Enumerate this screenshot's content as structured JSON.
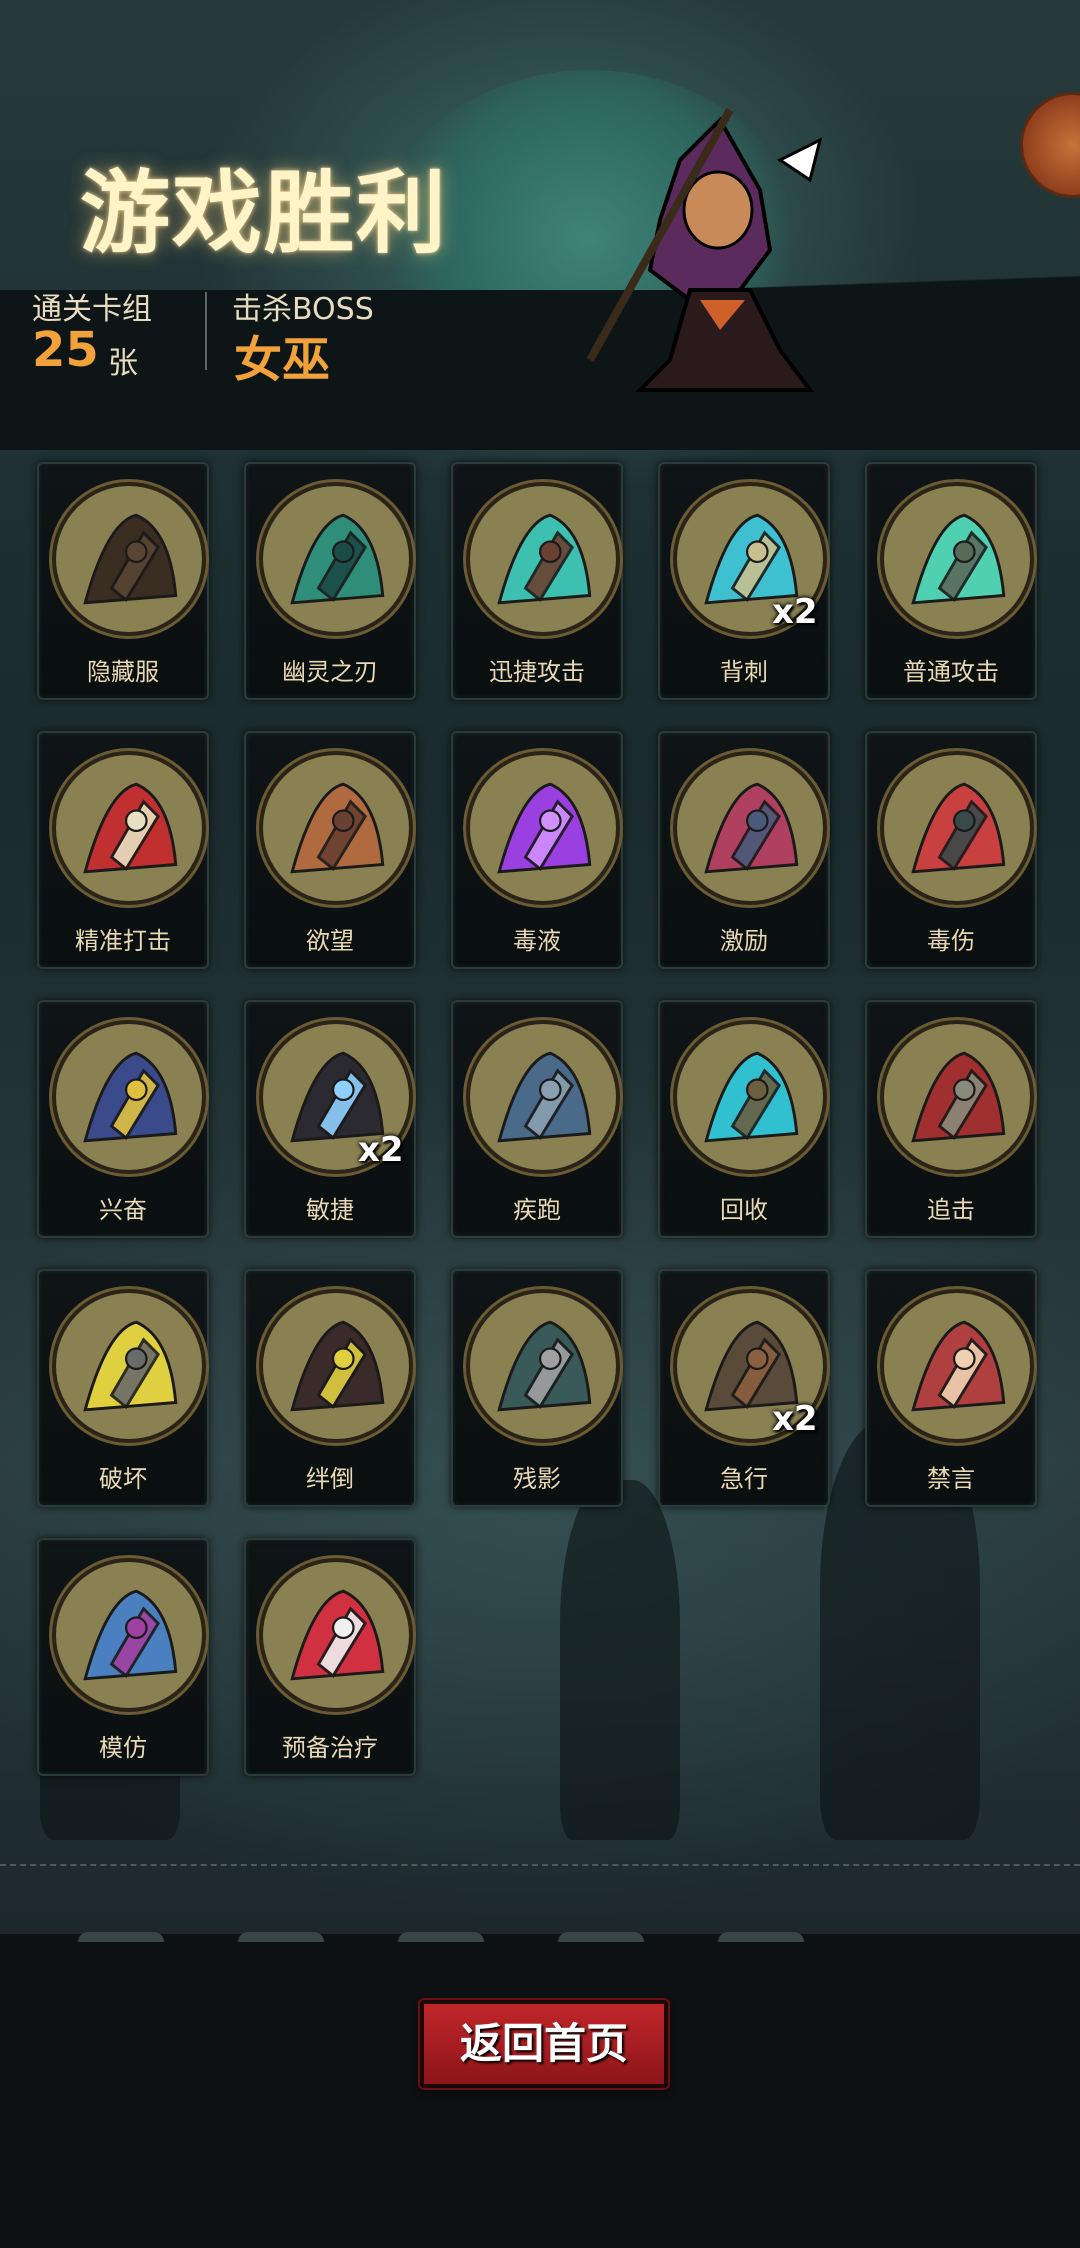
{
  "header": {
    "title": "游戏胜利",
    "deck_label": "通关卡组",
    "deck_count": "25",
    "deck_unit": "张",
    "boss_label": "击杀BOSS",
    "boss_name": "女巫"
  },
  "cards": [
    {
      "label": "隐藏服",
      "mult": "",
      "icon": "hood-cloak-icon"
    },
    {
      "label": "幽灵之刃",
      "mult": "",
      "icon": "ghost-dagger-icon"
    },
    {
      "label": "迅捷攻击",
      "mult": "",
      "icon": "swift-axe-icon"
    },
    {
      "label": "背刺",
      "mult": "x2",
      "icon": "backstab-icon"
    },
    {
      "label": "普通攻击",
      "mult": "",
      "icon": "spears-icon"
    },
    {
      "label": "精准打击",
      "mult": "",
      "icon": "target-arrows-icon"
    },
    {
      "label": "欲望",
      "mult": "",
      "icon": "greedy-toad-icon"
    },
    {
      "label": "毒液",
      "mult": "",
      "icon": "venom-splash-icon"
    },
    {
      "label": "激励",
      "mult": "",
      "icon": "hammer-warrior-icon"
    },
    {
      "label": "毒伤",
      "mult": "",
      "icon": "octopus-poison-icon"
    },
    {
      "label": "兴奋",
      "mult": "",
      "icon": "excited-dwarf-icon"
    },
    {
      "label": "敏捷",
      "mult": "x2",
      "icon": "black-panther-icon"
    },
    {
      "label": "疾跑",
      "mult": "",
      "icon": "sprinting-rat-icon"
    },
    {
      "label": "回收",
      "mult": "",
      "icon": "boomerang-icon"
    },
    {
      "label": "追击",
      "mult": "",
      "icon": "chasing-rider-icon"
    },
    {
      "label": "破坏",
      "mult": "",
      "icon": "smash-hammer-icon"
    },
    {
      "label": "绊倒",
      "mult": "",
      "icon": "trip-boot-icon"
    },
    {
      "label": "残影",
      "mult": "",
      "icon": "afterimage-hoods-icon"
    },
    {
      "label": "急行",
      "mult": "x2",
      "icon": "rushing-dwarf-icon"
    },
    {
      "label": "禁言",
      "mult": "",
      "icon": "silence-girl-icon"
    },
    {
      "label": "模仿",
      "mult": "",
      "icon": "goblin-mimic-icon"
    },
    {
      "label": "预备治疗",
      "mult": "",
      "icon": "heart-heal-icon"
    }
  ],
  "footer": {
    "home_button": "返回首页"
  }
}
